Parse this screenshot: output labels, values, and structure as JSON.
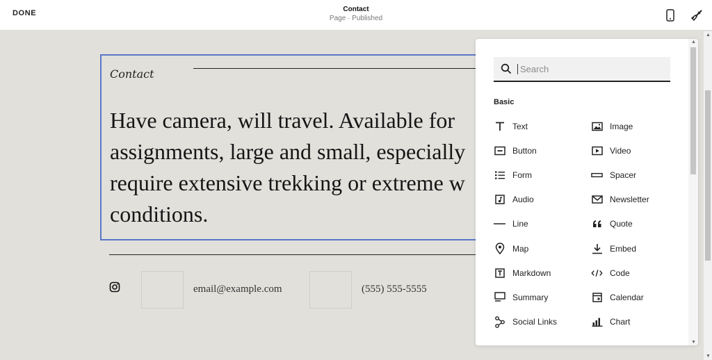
{
  "topbar": {
    "done_label": "DONE",
    "page_title": "Contact",
    "page_status": "Page · Published",
    "mobile_icon": "mobile-phone-icon",
    "design_icon": "paintbrush-icon"
  },
  "page": {
    "heading": "Contact",
    "body_lines": [
      "Have camera, will travel. Available for",
      "assignments, large and small, especially",
      "require extensive trekking or extreme w",
      "conditions."
    ],
    "email": "email@example.com",
    "phone": "(555) 555-5555",
    "selected_block_color": "#5b76c6"
  },
  "panel": {
    "search_placeholder": "Search",
    "section_label": "Basic",
    "items": [
      {
        "label": "Text",
        "icon": "text-icon"
      },
      {
        "label": "Image",
        "icon": "image-icon"
      },
      {
        "label": "Button",
        "icon": "button-icon"
      },
      {
        "label": "Video",
        "icon": "video-icon"
      },
      {
        "label": "Form",
        "icon": "form-icon"
      },
      {
        "label": "Spacer",
        "icon": "spacer-icon"
      },
      {
        "label": "Audio",
        "icon": "audio-icon"
      },
      {
        "label": "Newsletter",
        "icon": "newsletter-icon"
      },
      {
        "label": "Line",
        "icon": "line-icon"
      },
      {
        "label": "Quote",
        "icon": "quote-icon"
      },
      {
        "label": "Map",
        "icon": "map-pin-icon"
      },
      {
        "label": "Embed",
        "icon": "embed-icon"
      },
      {
        "label": "Markdown",
        "icon": "markdown-icon"
      },
      {
        "label": "Code",
        "icon": "code-icon"
      },
      {
        "label": "Summary",
        "icon": "summary-icon"
      },
      {
        "label": "Calendar",
        "icon": "calendar-icon"
      },
      {
        "label": "Social Links",
        "icon": "social-links-icon"
      },
      {
        "label": "Chart",
        "icon": "chart-icon"
      }
    ]
  }
}
